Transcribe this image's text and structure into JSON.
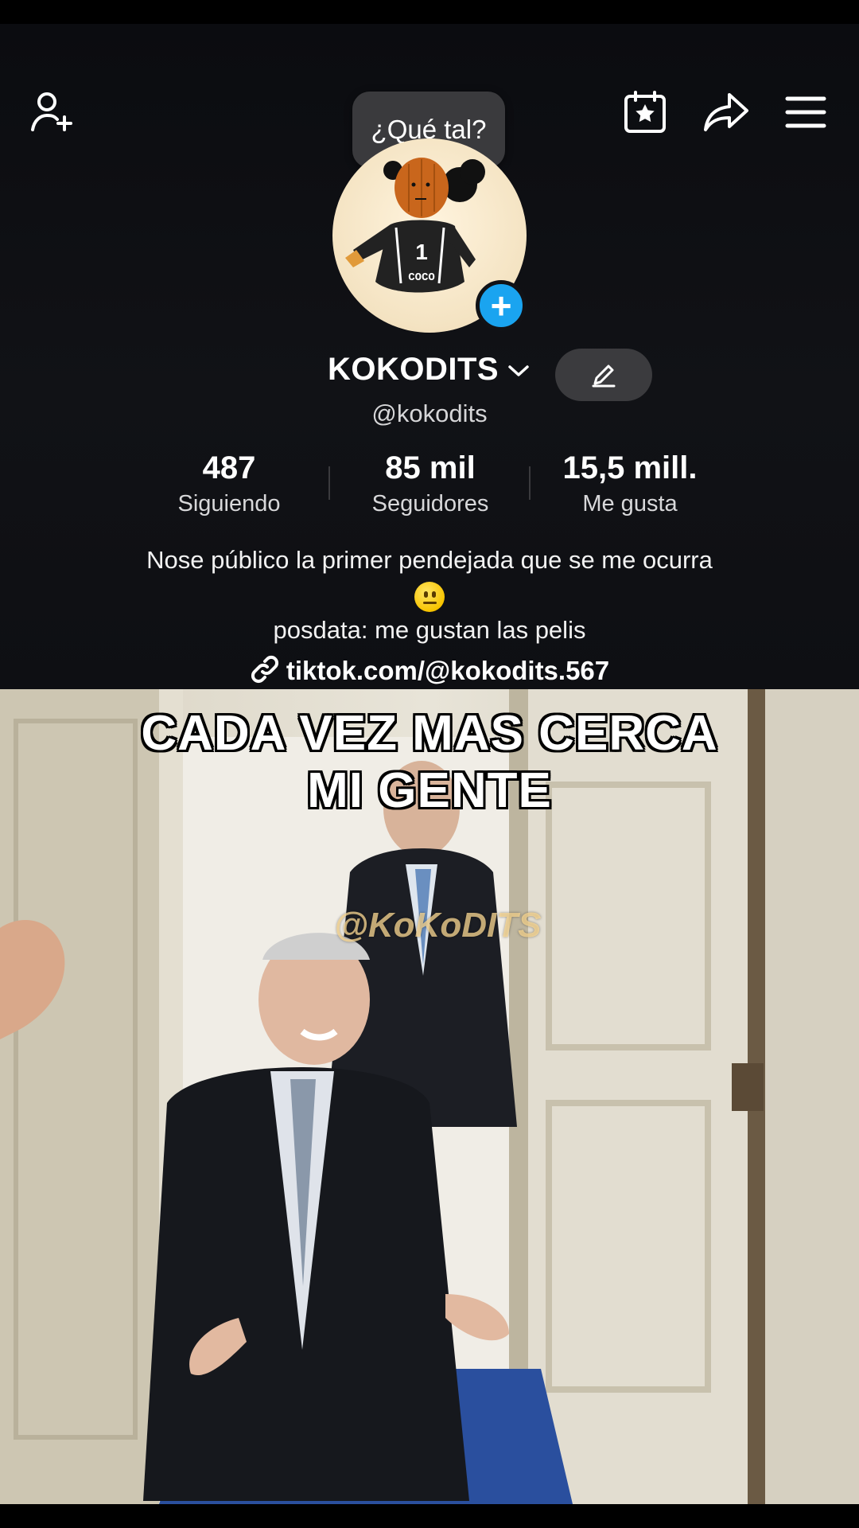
{
  "topbar": {
    "add_friend_icon": "person-plus-icon",
    "tooltip": "¿Qué tal?",
    "calendar_icon": "calendar-star-icon",
    "share_icon": "share-arrow-icon",
    "menu_icon": "hamburger-menu-icon"
  },
  "profile": {
    "display_name": "KOKODITS",
    "handle": "@kokodits",
    "stats": [
      {
        "value": "487",
        "label": "Siguiendo"
      },
      {
        "value": "85 mil",
        "label": "Seguidores"
      },
      {
        "value": "15,5 mill.",
        "label": "Me gusta"
      }
    ],
    "bio_line1": "Nose público la primer pendejada que se me ocurra",
    "bio_line2": "posdata: me gustan las pelis",
    "link": "tiktok.com/@kokodits.567",
    "avatar_jersey_number": "1",
    "avatar_jersey_text": "COCO"
  },
  "video": {
    "caption_line1": "CADA VEZ MAS CERCA",
    "caption_line2": "MI GENTE",
    "watermark": "@KoKoDITS"
  },
  "colors": {
    "accent_blue": "#1aa4f0",
    "background": "#111216",
    "edit_button": "#3b3b3e"
  }
}
